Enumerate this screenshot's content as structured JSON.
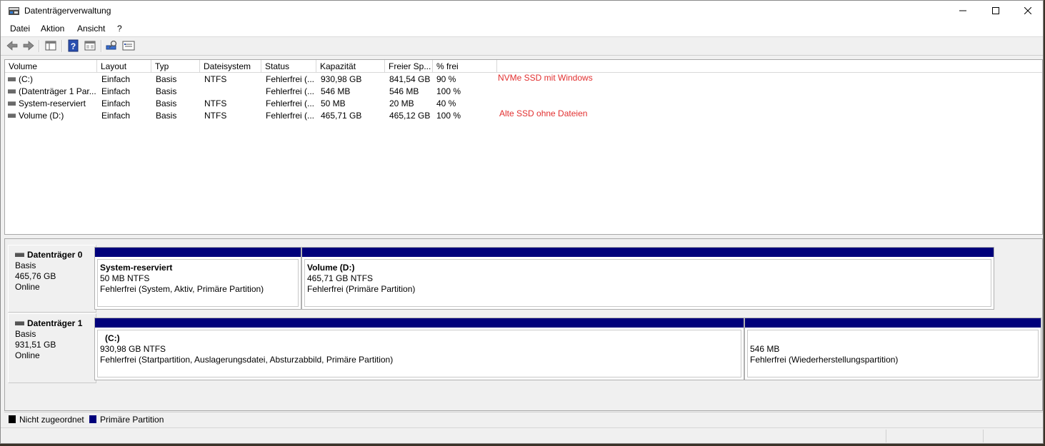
{
  "window": {
    "title": "Datenträgerverwaltung",
    "minimize": "—",
    "maximize": "☐",
    "close": "✕"
  },
  "menu": [
    "Datei",
    "Aktion",
    "Ansicht",
    "?"
  ],
  "toolbar": [
    "back-icon",
    "forward-icon",
    "console-tree-icon",
    "help-icon",
    "properties-icon",
    "rescan-icon",
    "settings-icon"
  ],
  "volume_table": {
    "columns": [
      "Volume",
      "Layout",
      "Typ",
      "Dateisystem",
      "Status",
      "Kapazität",
      "Freier Sp...",
      "% frei"
    ],
    "rows": [
      [
        "(C:)",
        "Einfach",
        "Basis",
        "NTFS",
        "Fehlerfrei (...",
        "930,98 GB",
        "841,54 GB",
        "90 %"
      ],
      [
        "(Datenträger 1 Par...",
        "Einfach",
        "Basis",
        "",
        "Fehlerfrei (...",
        "546 MB",
        "546 MB",
        "100 %"
      ],
      [
        "System-reserviert",
        "Einfach",
        "Basis",
        "NTFS",
        "Fehlerfrei (...",
        "50 MB",
        "20 MB",
        "40 %"
      ],
      [
        "Volume (D:)",
        "Einfach",
        "Basis",
        "NTFS",
        "Fehlerfrei (...",
        "465,71 GB",
        "465,12 GB",
        "100 %"
      ]
    ]
  },
  "annotations": {
    "nvme": "NVMe SSD mit Windows",
    "alte": "Alte SSD ohne Dateien"
  },
  "disks": [
    {
      "name": "Datenträger 0",
      "type": "Basis",
      "size": "465,76 GB",
      "state": "Online",
      "partitions": [
        {
          "name": "System-reserviert",
          "size": "50 MB NTFS",
          "status": "Fehlerfrei (System, Aktiv, Primäre Partition)"
        },
        {
          "name": "Volume  (D:)",
          "size": "465,71 GB NTFS",
          "status": "Fehlerfrei (Primäre Partition)"
        }
      ]
    },
    {
      "name": "Datenträger 1",
      "type": "Basis",
      "size": "931,51 GB",
      "state": "Online",
      "partitions": [
        {
          "name": "(C:)",
          "size": "930,98 GB NTFS",
          "status": "Fehlerfrei (Startpartition, Auslagerungsdatei, Absturzabbild, Primäre Partition)"
        },
        {
          "name": "",
          "size": "546 MB",
          "status": "Fehlerfrei (Wiederherstellungspartition)"
        }
      ]
    }
  ],
  "legend": [
    {
      "label": "Nicht zugeordnet",
      "color": "#000000"
    },
    {
      "label": "Primäre Partition",
      "color": "#00007b"
    }
  ]
}
